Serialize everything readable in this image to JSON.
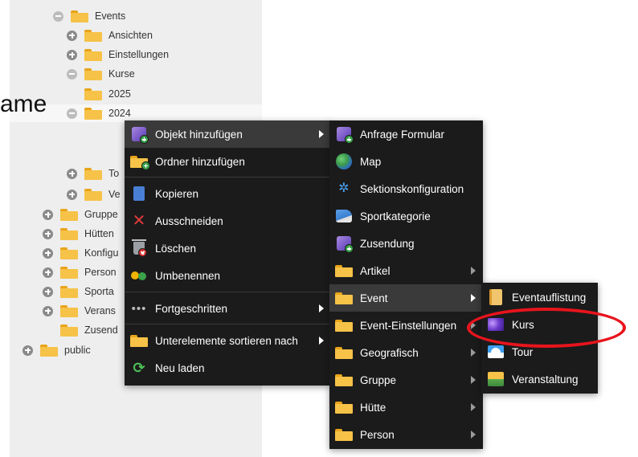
{
  "cut_off_text": "ame",
  "tree": {
    "nodes": [
      {
        "label": "Events",
        "toggle": "minus"
      },
      {
        "label": "Ansichten",
        "toggle": "plus"
      },
      {
        "label": "Einstellungen",
        "toggle": "plus"
      },
      {
        "label": "Kurse",
        "toggle": "minus"
      },
      {
        "label": "2025",
        "toggle": "none"
      },
      {
        "label": "2024",
        "toggle": "minus",
        "selected": true
      },
      {
        "label": "To",
        "toggle": "plus"
      },
      {
        "label": "Ve",
        "toggle": "plus"
      },
      {
        "label": "Gruppe",
        "toggle": "plus"
      },
      {
        "label": "Hütten",
        "toggle": "plus"
      },
      {
        "label": "Konfigu",
        "toggle": "plus"
      },
      {
        "label": "Person",
        "toggle": "plus"
      },
      {
        "label": "Sporta",
        "toggle": "plus"
      },
      {
        "label": "Verans",
        "toggle": "plus"
      },
      {
        "label": "Zusend",
        "toggle": "none"
      },
      {
        "label": "public",
        "toggle": "plus"
      }
    ]
  },
  "context_menu": {
    "items": [
      {
        "label": "Objekt hinzufügen",
        "icon": "cube-add-icon",
        "submenu": true,
        "highlighted": true
      },
      {
        "label": "Ordner hinzufügen",
        "icon": "folder-add-icon"
      },
      {
        "label": "Kopieren",
        "icon": "copy-icon"
      },
      {
        "label": "Ausschneiden",
        "icon": "cut-icon"
      },
      {
        "label": "Löschen",
        "icon": "delete-icon"
      },
      {
        "label": "Umbenennen",
        "icon": "rename-icon"
      },
      {
        "label": "Fortgeschritten",
        "icon": "more-dots-icon",
        "submenu": true
      },
      {
        "label": "Unterelemente sortieren nach",
        "icon": "folder-icon",
        "submenu": true
      },
      {
        "label": "Neu laden",
        "icon": "reload-icon"
      }
    ]
  },
  "object_submenu": {
    "items": [
      {
        "label": "Anfrage Formular",
        "icon": "cube-add-icon"
      },
      {
        "label": "Map",
        "icon": "globe-icon"
      },
      {
        "label": "Sektionskonfiguration",
        "icon": "network-icon"
      },
      {
        "label": "Sportkategorie",
        "icon": "shoe-icon"
      },
      {
        "label": "Zusendung",
        "icon": "cube-add-icon"
      },
      {
        "label": "Artikel",
        "icon": "folder-icon",
        "submenu": true
      },
      {
        "label": "Event",
        "icon": "folder-icon",
        "submenu": true,
        "highlighted": true
      },
      {
        "label": "Event-Einstellungen",
        "icon": "folder-icon",
        "submenu": true
      },
      {
        "label": "Geografisch",
        "icon": "folder-icon",
        "submenu": true
      },
      {
        "label": "Gruppe",
        "icon": "folder-icon",
        "submenu": true
      },
      {
        "label": "Hütte",
        "icon": "folder-icon",
        "submenu": true
      },
      {
        "label": "Person",
        "icon": "folder-icon",
        "submenu": true
      }
    ]
  },
  "event_submenu": {
    "items": [
      {
        "label": "Eventauflistung",
        "icon": "scroll-icon"
      },
      {
        "label": "Kurs",
        "icon": "kurs-icon",
        "circled": true
      },
      {
        "label": "Tour",
        "icon": "tour-icon"
      },
      {
        "label": "Veranstaltung",
        "icon": "veranstaltung-icon"
      }
    ]
  },
  "colors": {
    "menu_bg": "#1b1b1b",
    "menu_highlight": "#3a3a3a",
    "tree_bg": "#eeeeee",
    "annotation_circle": "#e8141c",
    "folder": "#f6c247"
  }
}
